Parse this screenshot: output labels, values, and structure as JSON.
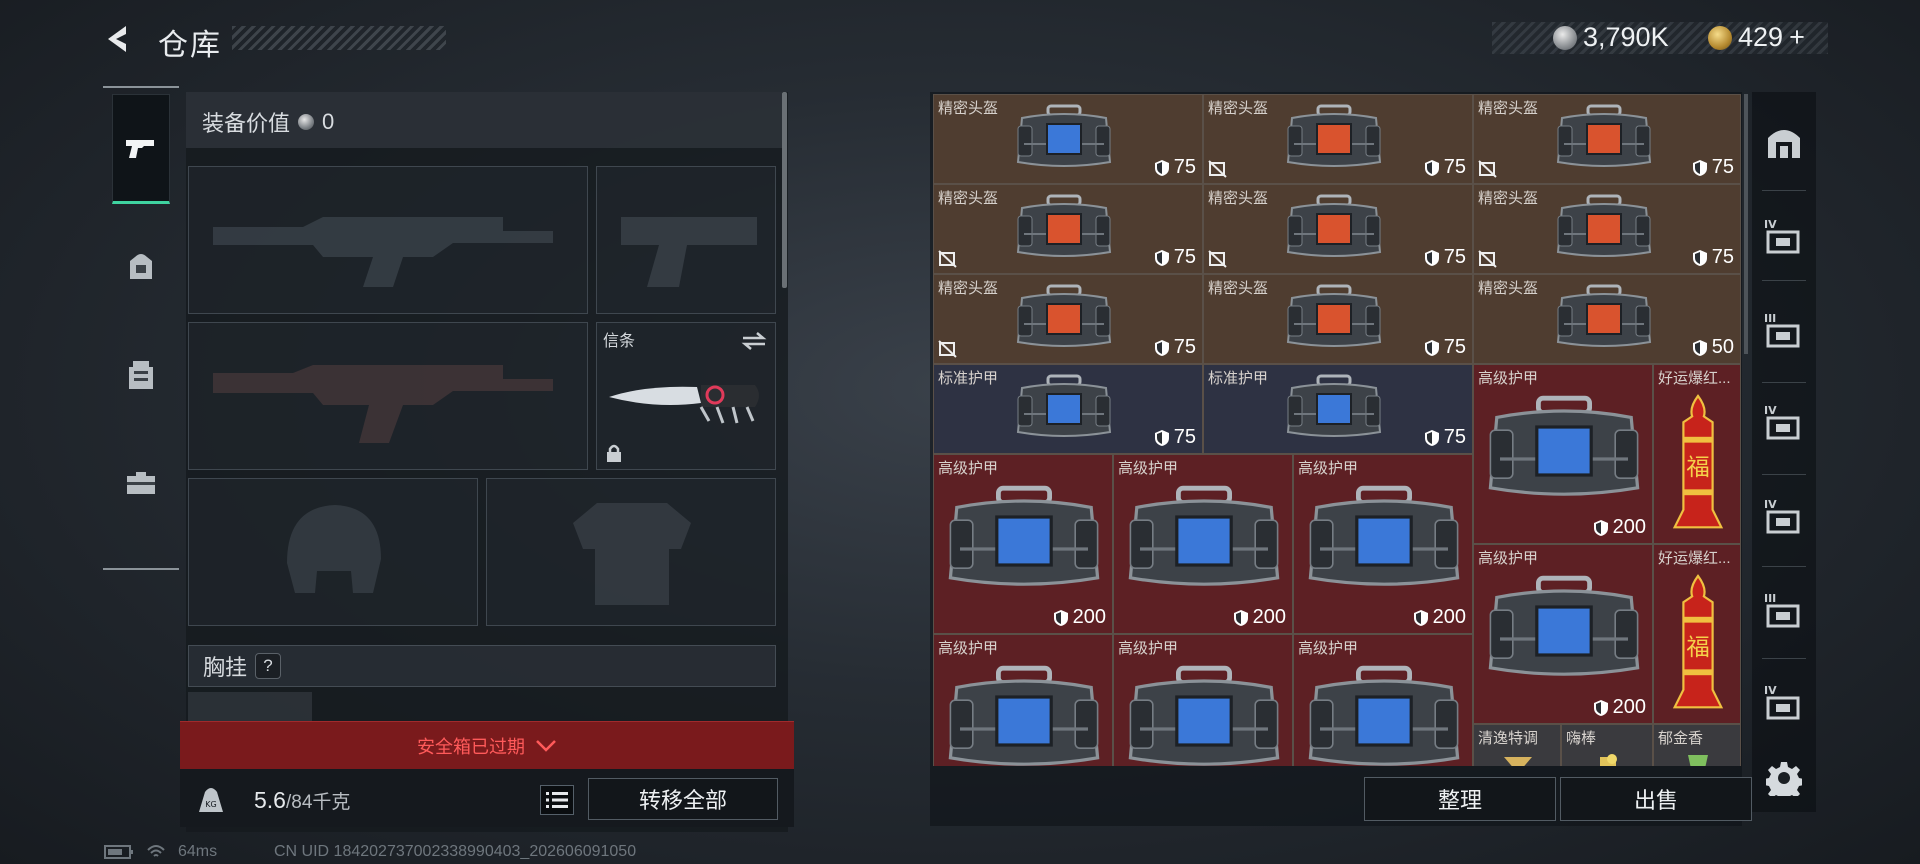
{
  "header": {
    "title": "仓库",
    "currency1": "3,790K",
    "currency2": "429",
    "plus": "+"
  },
  "left": {
    "equip_value_label": "装备价值",
    "equip_value": "0",
    "melee_name": "信条",
    "chest_label": "胸挂",
    "chest_help": "?",
    "safebox_status": "安全箱已过期",
    "weight_current": "5.6",
    "weight_max": "/84千克",
    "transfer_all": "转移全部",
    "kg_icon_text": "KG"
  },
  "items": [
    {
      "name": "精密头盔",
      "durability": "75",
      "color": "blue"
    },
    {
      "name": "精密头盔",
      "durability": "75",
      "color": "orange"
    },
    {
      "name": "精密头盔",
      "durability": "75",
      "color": "orange"
    },
    {
      "name": "精密头盔",
      "durability": "75",
      "color": "orange"
    },
    {
      "name": "精密头盔",
      "durability": "75",
      "color": "orange"
    },
    {
      "name": "精密头盔",
      "durability": "75",
      "color": "orange"
    },
    {
      "name": "精密头盔",
      "durability": "75",
      "color": "orange"
    },
    {
      "name": "精密头盔",
      "durability": "75",
      "color": "orange"
    },
    {
      "name": "精密头盔",
      "durability": "50",
      "color": "orange"
    },
    {
      "name": "标准护甲",
      "durability": "75",
      "color": "blue"
    },
    {
      "name": "标准护甲",
      "durability": "75",
      "color": "blue"
    },
    {
      "name": "高级护甲",
      "durability": "200",
      "color": "blue"
    },
    {
      "name": "好运爆红...",
      "durability": "",
      "color": "red"
    },
    {
      "name": "高级护甲",
      "durability": "200",
      "color": "blue"
    },
    {
      "name": "高级护甲",
      "durability": "200",
      "color": "blue"
    },
    {
      "name": "高级护甲",
      "durability": "200",
      "color": "blue"
    },
    {
      "name": "高级护甲",
      "durability": "200",
      "color": "blue"
    },
    {
      "name": "好运爆红...",
      "durability": "",
      "color": "red"
    },
    {
      "name": "高级护甲",
      "durability": "",
      "color": "blue"
    },
    {
      "name": "高级护甲",
      "durability": "",
      "color": "blue"
    },
    {
      "name": "高级护甲",
      "durability": "",
      "color": "blue"
    },
    {
      "name": "清逸特调",
      "durability": "",
      "color": "gray"
    },
    {
      "name": "嗨棒",
      "durability": "",
      "color": "gray"
    },
    {
      "name": "郁金香",
      "durability": "",
      "color": "gray"
    }
  ],
  "firecracker_glyph": "福",
  "tier_labels": [
    "IV",
    "III",
    "IV",
    "IV",
    "III",
    "IV"
  ],
  "buttons": {
    "sort": "整理",
    "sell": "出售"
  },
  "status": {
    "ping": "64ms",
    "uid": "CN UID 184202737002338990403_202606091050"
  }
}
